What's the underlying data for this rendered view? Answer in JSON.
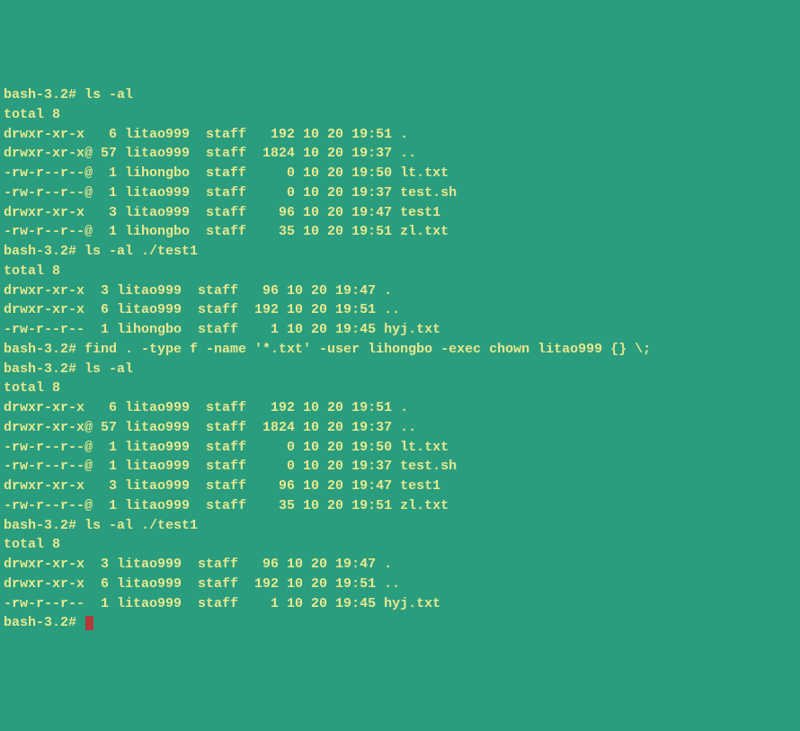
{
  "lines": [
    "bash-3.2# ls -al",
    "total 8",
    "drwxr-xr-x   6 litao999  staff   192 10 20 19:51 .",
    "drwxr-xr-x@ 57 litao999  staff  1824 10 20 19:37 ..",
    "-rw-r--r--@  1 lihongbo  staff     0 10 20 19:50 lt.txt",
    "-rw-r--r--@  1 litao999  staff     0 10 20 19:37 test.sh",
    "drwxr-xr-x   3 litao999  staff    96 10 20 19:47 test1",
    "-rw-r--r--@  1 lihongbo  staff    35 10 20 19:51 zl.txt",
    "bash-3.2# ls -al ./test1",
    "total 8",
    "drwxr-xr-x  3 litao999  staff   96 10 20 19:47 .",
    "drwxr-xr-x  6 litao999  staff  192 10 20 19:51 ..",
    "-rw-r--r--  1 lihongbo  staff    1 10 20 19:45 hyj.txt",
    "bash-3.2# find . -type f -name '*.txt' -user lihongbo -exec chown litao999 {} \\;",
    "",
    "bash-3.2# ls -al",
    "total 8",
    "drwxr-xr-x   6 litao999  staff   192 10 20 19:51 .",
    "drwxr-xr-x@ 57 litao999  staff  1824 10 20 19:37 ..",
    "-rw-r--r--@  1 litao999  staff     0 10 20 19:50 lt.txt",
    "-rw-r--r--@  1 litao999  staff     0 10 20 19:37 test.sh",
    "drwxr-xr-x   3 litao999  staff    96 10 20 19:47 test1",
    "-rw-r--r--@  1 litao999  staff    35 10 20 19:51 zl.txt",
    "bash-3.2# ls -al ./test1",
    "total 8",
    "drwxr-xr-x  3 litao999  staff   96 10 20 19:47 .",
    "drwxr-xr-x  6 litao999  staff  192 10 20 19:51 ..",
    "-rw-r--r--  1 litao999  staff    1 10 20 19:45 hyj.txt"
  ],
  "prompt": "bash-3.2# "
}
